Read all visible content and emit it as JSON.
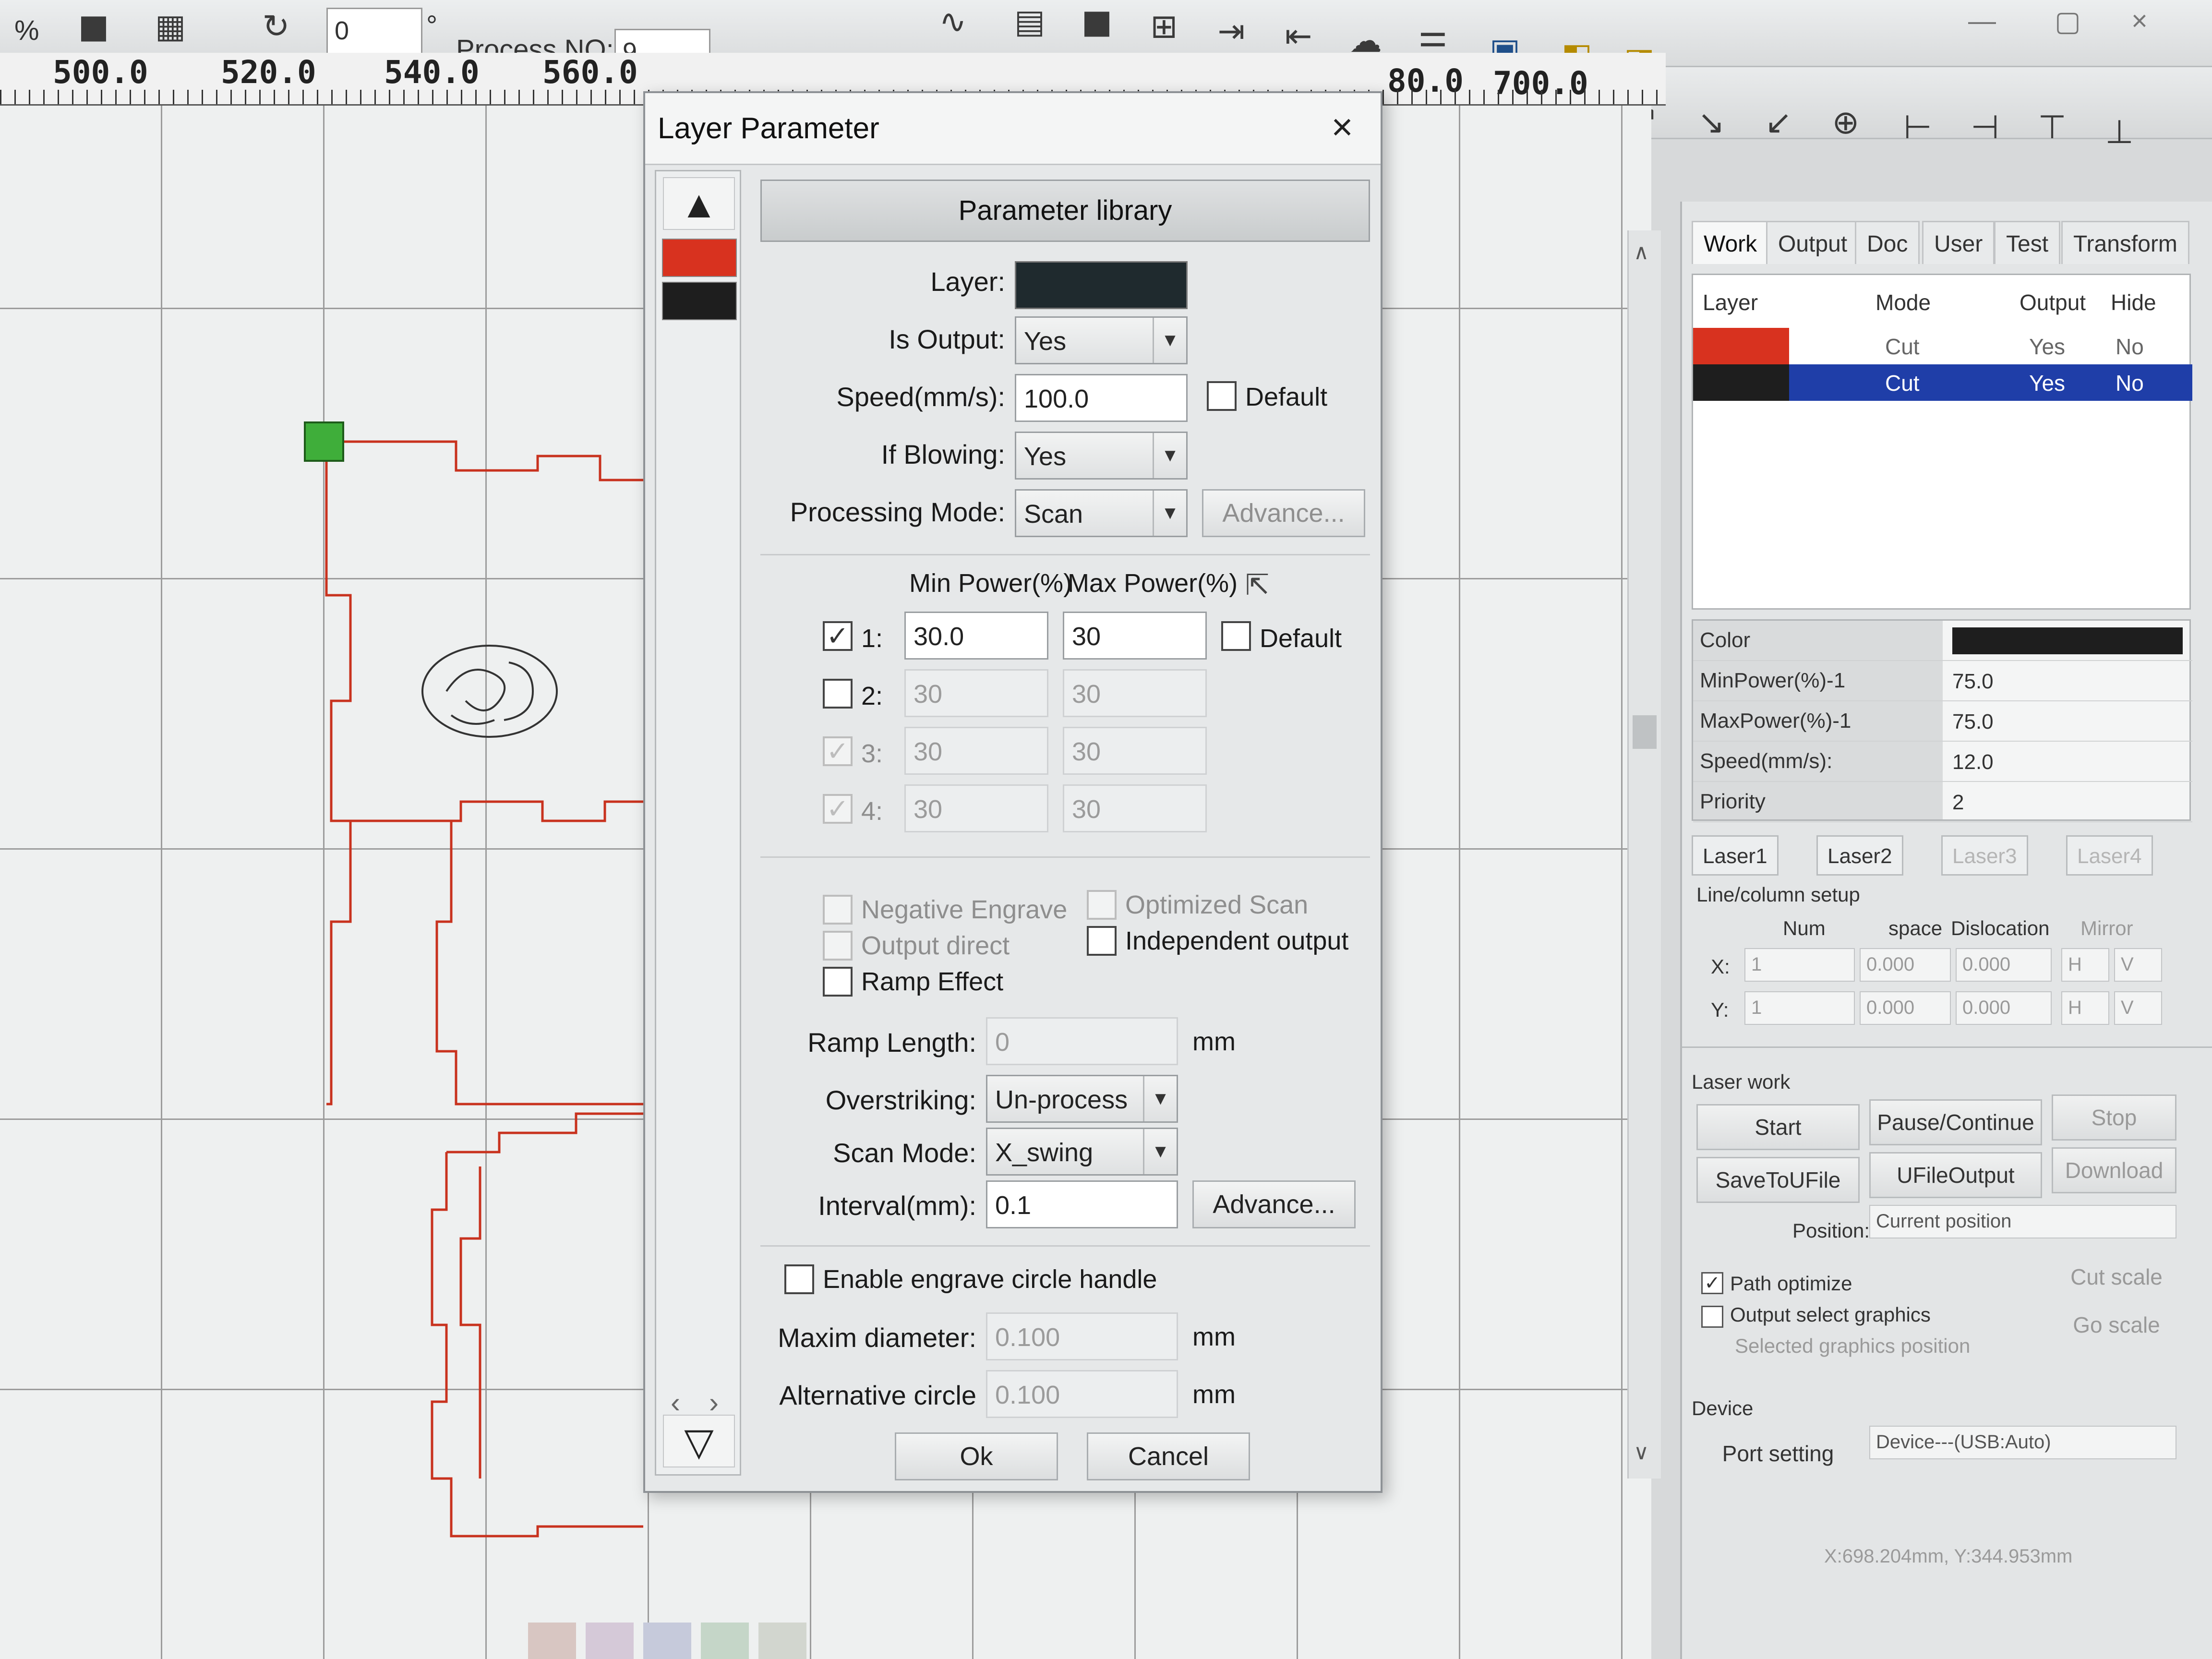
{
  "toolbar": {
    "zoom_label": "%",
    "angle_value": "0",
    "angle_unit": "°",
    "process_no_label": "Process NO:",
    "process_no_value": "9"
  },
  "ruler": {
    "labels_left": [
      "500.0",
      "520.0",
      "540.0",
      "560.0"
    ],
    "labels_right": [
      "80.0",
      "700.0"
    ]
  },
  "dialog": {
    "title": "Layer Parameter",
    "close_glyph": "×",
    "parameter_library_label": "Parameter library",
    "layer_label": "Layer:",
    "layer_color": "#1f2a2e",
    "is_output_label": "Is Output:",
    "is_output_value": "Yes",
    "speed_label": "Speed(mm/s):",
    "speed_value": "100.0",
    "speed_default_label": "Default",
    "if_blowing_label": "If Blowing:",
    "if_blowing_value": "Yes",
    "processing_mode_label": "Processing Mode:",
    "processing_mode_value": "Scan",
    "advance_label_1": "Advance...",
    "min_power_header": "Min Power(%)",
    "max_power_header": "Max Power(%)",
    "power_default_label": "Default",
    "power_rows": [
      {
        "index": "1:",
        "checked": true,
        "enabled": true,
        "min": "30.0",
        "max": "30"
      },
      {
        "index": "2:",
        "checked": false,
        "enabled": true,
        "min": "30",
        "max": "30"
      },
      {
        "index": "3:",
        "checked": true,
        "enabled": false,
        "min": "30",
        "max": "30"
      },
      {
        "index": "4:",
        "checked": true,
        "enabled": false,
        "min": "30",
        "max": "30"
      }
    ],
    "negative_engrave_label": "Negative Engrave",
    "optimized_scan_label": "Optimized Scan",
    "output_direct_label": "Output direct",
    "independent_output_label": "Independent output",
    "ramp_effect_label": "Ramp Effect",
    "ramp_length_label": "Ramp Length:",
    "ramp_length_value": "0",
    "ramp_length_unit": "mm",
    "overstriking_label": "Overstriking:",
    "overstriking_value": "Un-process",
    "scan_mode_label": "Scan Mode:",
    "scan_mode_value": "X_swing",
    "interval_label": "Interval(mm):",
    "interval_value": "0.1",
    "advance_label_2": "Advance...",
    "enable_circle_label": "Enable engrave circle handle",
    "maxim_diameter_label": "Maxim diameter:",
    "maxim_diameter_value": "0.100",
    "maxim_diameter_unit": "mm",
    "alternative_circle_label": "Alternative circle",
    "alternative_circle_value": "0.100",
    "alternative_circle_unit": "mm",
    "ok_label": "Ok",
    "cancel_label": "Cancel",
    "strip_colors": [
      "#d8321f",
      "#1e1e1e"
    ]
  },
  "right_panel": {
    "tabs": [
      "Work",
      "Output",
      "Doc",
      "User",
      "Test",
      "Transform"
    ],
    "layer_table": {
      "headers": [
        "Layer",
        "Mode",
        "Output",
        "Hide"
      ],
      "rows": [
        {
          "color": "#d8321f",
          "mode": "Cut",
          "output": "Yes",
          "hide": "No",
          "selected": false
        },
        {
          "color": "#1e1e1e",
          "mode": "Cut",
          "output": "Yes",
          "hide": "No",
          "selected": true
        }
      ]
    },
    "properties": [
      {
        "key": "Color",
        "value": ""
      },
      {
        "key": "MinPower(%)-1",
        "value": "75.0"
      },
      {
        "key": "MaxPower(%)-1",
        "value": "75.0"
      },
      {
        "key": "Speed(mm/s):",
        "value": "12.0"
      },
      {
        "key": "Priority",
        "value": "2"
      }
    ],
    "property_color": "#1e1e1e",
    "laser_tabs": [
      "Laser1",
      "Laser2",
      "Laser3",
      "Laser4"
    ],
    "line_column_setup_label": "Line/column setup",
    "lc_headers": [
      "Num",
      "space",
      "Dislocation",
      "Mirror"
    ],
    "lc_rows": [
      {
        "axis": "X:",
        "num": "1",
        "space": "0.000",
        "dislocation": "0.000",
        "mirror_a": "H",
        "mirror_b": "V"
      },
      {
        "axis": "Y:",
        "num": "1",
        "space": "0.000",
        "dislocation": "0.000",
        "mirror_a": "H",
        "mirror_b": "V"
      }
    ],
    "laser_work_label": "Laser work",
    "start_label": "Start",
    "pause_continue_label": "Pause/Continue",
    "stop_label": "Stop",
    "save_to_ufile_label": "SaveToUFile",
    "ufile_output_label": "UFileOutput",
    "download_label": "Download",
    "position_label": "Position:",
    "position_value": "Current position",
    "path_optimize_label": "Path optimize",
    "output_select_graphics_label": "Output select graphics",
    "selected_graphics_position_label": "Selected graphics position",
    "cut_scale_label": "Cut scale",
    "go_scale_label": "Go scale",
    "device_label": "Device",
    "port_setting_label": "Port setting",
    "device_value": "Device---(USB:Auto)"
  },
  "status": {
    "coords": "X:698.204mm, Y:344.953mm"
  },
  "colors": {
    "cut_path": "#c8321e",
    "selection_handle": "#3fae3a",
    "selected_row": "#1f3ea8"
  }
}
